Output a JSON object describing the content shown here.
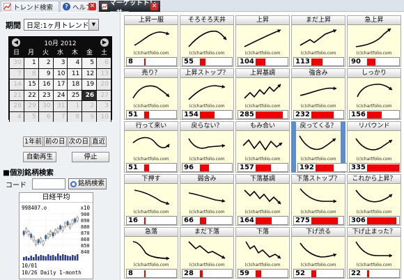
{
  "tabs": [
    {
      "label": "トレンド検索",
      "icon": "chart-icon"
    },
    {
      "label": "ヘルプ",
      "icon": "help-icon"
    },
    {
      "label": "マーケットトレーサー",
      "icon": "chart-icon"
    }
  ],
  "period": {
    "label": "期間",
    "selected": "日足:1ヶ月トレンド"
  },
  "calendar": {
    "title": "10月 2012",
    "dow": [
      "日",
      "月",
      "火",
      "水",
      "木",
      "金",
      "土"
    ],
    "days": [
      {
        "d": "30",
        "m": true
      },
      {
        "d": "1"
      },
      {
        "d": "2"
      },
      {
        "d": "3"
      },
      {
        "d": "4"
      },
      {
        "d": "5"
      },
      {
        "d": "6",
        "m": true
      },
      {
        "d": "7",
        "m": true
      },
      {
        "d": "8",
        "m": true
      },
      {
        "d": "9"
      },
      {
        "d": "10"
      },
      {
        "d": "11"
      },
      {
        "d": "12"
      },
      {
        "d": "13",
        "m": true
      },
      {
        "d": "14",
        "m": true
      },
      {
        "d": "15"
      },
      {
        "d": "16"
      },
      {
        "d": "17"
      },
      {
        "d": "18"
      },
      {
        "d": "19"
      },
      {
        "d": "20",
        "m": true
      },
      {
        "d": "21",
        "m": true
      },
      {
        "d": "22"
      },
      {
        "d": "23"
      },
      {
        "d": "24"
      },
      {
        "d": "25"
      },
      {
        "d": "26",
        "sel": true
      },
      {
        "d": "27",
        "m": true
      },
      {
        "d": "28",
        "m": true
      },
      {
        "d": "29",
        "m": true
      },
      {
        "d": "30",
        "m": true
      },
      {
        "d": "31",
        "m": true
      },
      {
        "d": "1",
        "m": true
      },
      {
        "d": "2",
        "m": true
      },
      {
        "d": "3",
        "m": true
      },
      {
        "d": "4",
        "m": true
      },
      {
        "d": "5",
        "m": true
      },
      {
        "d": "6",
        "m": true
      },
      {
        "d": "7",
        "m": true
      },
      {
        "d": "8",
        "m": true
      },
      {
        "d": "9",
        "m": true
      },
      {
        "d": "10",
        "m": true
      }
    ]
  },
  "buttons": {
    "prev_year": "1年前",
    "prev_day": "前の日",
    "next_day": "次の日",
    "latest": "直近",
    "autoplay": "自動再生",
    "stop": "停止"
  },
  "search": {
    "title": "■個別銘柄検索",
    "code_label": "コード",
    "code_value": "",
    "button": "銘柄検索"
  },
  "nikkei": {
    "title": "日経平均",
    "price_line": "998407.o",
    "scale": "x10",
    "yticks": [
      "900",
      "890",
      "880",
      "870",
      "860",
      "850",
      "840"
    ],
    "date_label": "10/01",
    "footer": "10/26 Daily 1-month"
  },
  "patterns": [
    {
      "title": "上昇一服",
      "count": 8,
      "shape": "rise-flat"
    },
    {
      "title": "そろそろ天井",
      "count": 55,
      "shape": "top"
    },
    {
      "title": "上昇",
      "count": 104,
      "shape": "rise"
    },
    {
      "title": "まだ上昇",
      "count": 113,
      "shape": "rise-dip"
    },
    {
      "title": "急上昇",
      "count": 90,
      "shape": "surge"
    },
    {
      "title": "売り？",
      "count": 51,
      "shape": "hump"
    },
    {
      "title": "上昇ストップ？",
      "count": 154,
      "shape": "rise-stop"
    },
    {
      "title": "上昇基調",
      "count": 285,
      "shape": "zigzag-up"
    },
    {
      "title": "強含み",
      "count": 232,
      "shape": "gentle-up"
    },
    {
      "title": "しっかり",
      "count": 156,
      "shape": "convex-up"
    },
    {
      "title": "行って来い",
      "count": 51,
      "shape": "round-trip"
    },
    {
      "title": "戻らない？",
      "count": 96,
      "shape": "dip-flat"
    },
    {
      "title": "もみ合い",
      "count": 157,
      "shape": "zigzag-flat"
    },
    {
      "title": "戻ってくる？",
      "count": 192,
      "shape": "valley",
      "highlight": true
    },
    {
      "title": "リバウンド",
      "count": 335,
      "shape": "rebound"
    },
    {
      "title": "下押す",
      "count": 16,
      "shape": "fall-end"
    },
    {
      "title": "弱含み",
      "count": 66,
      "shape": "gentle-down"
    },
    {
      "title": "下落基調",
      "count": 164,
      "shape": "zigzag-down"
    },
    {
      "title": "下落ストップ？",
      "count": 275,
      "shape": "fall-stop"
    },
    {
      "title": "これから上昇？",
      "count": 306,
      "shape": "bowl"
    },
    {
      "title": "急落",
      "count": 8,
      "shape": "plunge"
    },
    {
      "title": "まだ下落",
      "count": 28,
      "shape": "fall-bump"
    },
    {
      "title": "下落",
      "count": 59,
      "shape": "fall-zig"
    },
    {
      "title": "下げ渋る",
      "count": 52,
      "shape": "fall-slow"
    },
    {
      "title": "下げ止まった？",
      "count": 22,
      "shape": "fall-flat"
    }
  ],
  "watermark": "(c)chartfolio.com",
  "colors": {
    "bar": "#f00000",
    "cell_bg": "#ffffde",
    "highlight": "#5d8ec9"
  }
}
